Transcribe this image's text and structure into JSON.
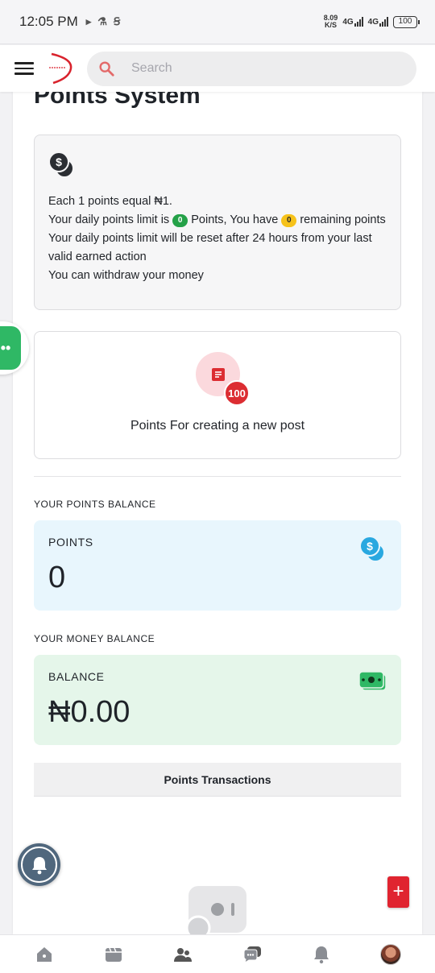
{
  "status_bar": {
    "time": "12:05 PM",
    "speed_top": "8.09",
    "speed_bottom": "K/S",
    "net1": "4G",
    "net2": "4G",
    "battery": "100"
  },
  "header": {
    "search_placeholder": "Search"
  },
  "page": {
    "title": "Points System"
  },
  "info": {
    "line1": "Each 1 points equal ₦1.",
    "line2_a": "Your daily points limit is",
    "limit_value": "0",
    "line2_b": "Points, You have",
    "remaining_value": "0",
    "line2_c": "remaining points",
    "line3": "Your daily points limit will be reset after 24 hours from your last valid earned action",
    "line4": "You can withdraw your money"
  },
  "post_reward": {
    "badge": "100",
    "label": "Points For creating a new post"
  },
  "points_balance": {
    "section": "YOUR POINTS BALANCE",
    "label": "POINTS",
    "value": "0"
  },
  "money_balance": {
    "section": "YOUR MONEY BALANCE",
    "label": "BALANCE",
    "value": "₦0.00"
  },
  "transactions_button": "Points Transactions",
  "colors": {
    "accent_red": "#dc2d32",
    "green": "#24a148",
    "blue": "#29a8e0",
    "yellow": "#f6c21a"
  },
  "bottom_nav": [
    "home-icon",
    "video-icon",
    "users-icon",
    "chat-icon",
    "bell-icon",
    "profile-avatar"
  ]
}
